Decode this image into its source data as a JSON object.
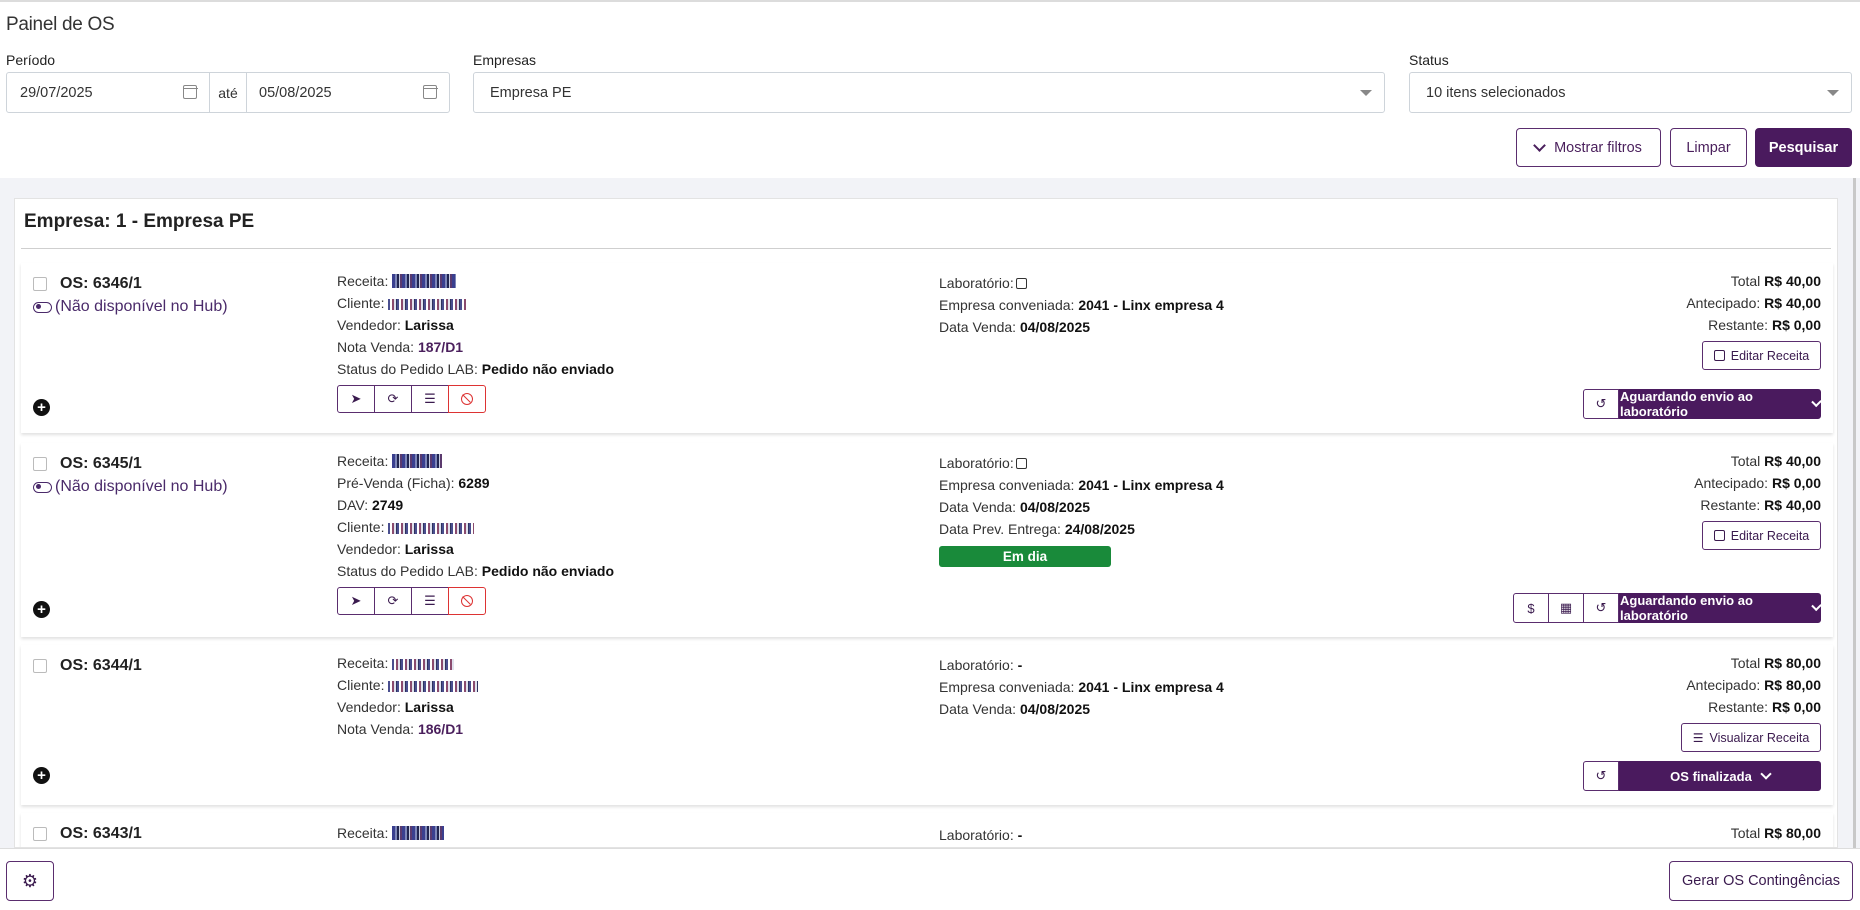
{
  "page": {
    "title": "Painel de OS"
  },
  "filters": {
    "period_label": "Período",
    "date_from": "29/07/2025",
    "date_sep": "até",
    "date_to": "05/08/2025",
    "empresas_label": "Empresas",
    "empresas_value": "Empresa PE",
    "status_label": "Status",
    "status_value": "10 itens selecionados",
    "show_filters": "Mostrar filtros",
    "clear": "Limpar",
    "search": "Pesquisar"
  },
  "panel": {
    "title": "Empresa: 1 - Empresa PE"
  },
  "cards": [
    {
      "os": "OS: 6346/1",
      "hub": "(Não disponível no Hub)",
      "receita_label": "Receita:",
      "cliente_label": "Cliente:",
      "vendedor_label": "Vendedor:",
      "vendedor": "Larissa",
      "nota_label": "Nota Venda:",
      "nota": "187/D1",
      "status_lab_label": "Status do Pedido LAB:",
      "status_lab": "Pedido não enviado",
      "lab_label": "Laboratório:",
      "conv_label": "Empresa conveniada:",
      "conv": "2041 - Linx empresa 4",
      "data_label": "Data Venda:",
      "data": "04/08/2025",
      "total_label": "Total",
      "total": "R$ 40,00",
      "antecipado_label": "Antecipado:",
      "antecipado": "R$ 40,00",
      "restante_label": "Restante:",
      "restante": "R$ 0,00",
      "receita_btn": "Editar Receita",
      "status": "Aguardando envio ao laboratório"
    },
    {
      "os": "OS: 6345/1",
      "hub": "(Não disponível no Hub)",
      "receita_label": "Receita:",
      "prevenda_label": "Pré-Venda (Ficha):",
      "prevenda": "6289",
      "dav_label": "DAV:",
      "dav": "2749",
      "cliente_label": "Cliente:",
      "vendedor_label": "Vendedor:",
      "vendedor": "Larissa",
      "status_lab_label": "Status do Pedido LAB:",
      "status_lab": "Pedido não enviado",
      "lab_label": "Laboratório:",
      "conv_label": "Empresa conveniada:",
      "conv": "2041 - Linx empresa 4",
      "data_label": "Data Venda:",
      "data": "04/08/2025",
      "prev_label": "Data Prev. Entrega:",
      "prev": "24/08/2025",
      "badge": "Em dia",
      "total_label": "Total",
      "total": "R$ 40,00",
      "antecipado_label": "Antecipado:",
      "antecipado": "R$ 0,00",
      "restante_label": "Restante:",
      "restante": "R$ 40,00",
      "receita_btn": "Editar Receita",
      "status": "Aguardando envio ao laboratório"
    },
    {
      "os": "OS: 6344/1",
      "receita_label": "Receita:",
      "cliente_label": "Cliente:",
      "vendedor_label": "Vendedor:",
      "vendedor": "Larissa",
      "nota_label": "Nota Venda:",
      "nota": "186/D1",
      "lab_label": "Laboratório:",
      "lab": "-",
      "conv_label": "Empresa conveniada:",
      "conv": "2041 - Linx empresa 4",
      "data_label": "Data Venda:",
      "data": "04/08/2025",
      "total_label": "Total",
      "total": "R$ 80,00",
      "antecipado_label": "Antecipado:",
      "antecipado": "R$ 80,00",
      "restante_label": "Restante:",
      "restante": "R$ 0,00",
      "receita_btn": "Visualizar Receita",
      "status": "OS finalizada"
    },
    {
      "os": "OS: 6343/1",
      "receita_label": "Receita:",
      "lab_label": "Laboratório:",
      "lab": "-",
      "total_label": "Total",
      "total": "R$ 80,00"
    }
  ],
  "footer": {
    "gerar": "Gerar OS Contingências"
  },
  "colors": {
    "primary": "#4a1a5e",
    "success": "#198a3a",
    "danger": "#dd3333"
  }
}
